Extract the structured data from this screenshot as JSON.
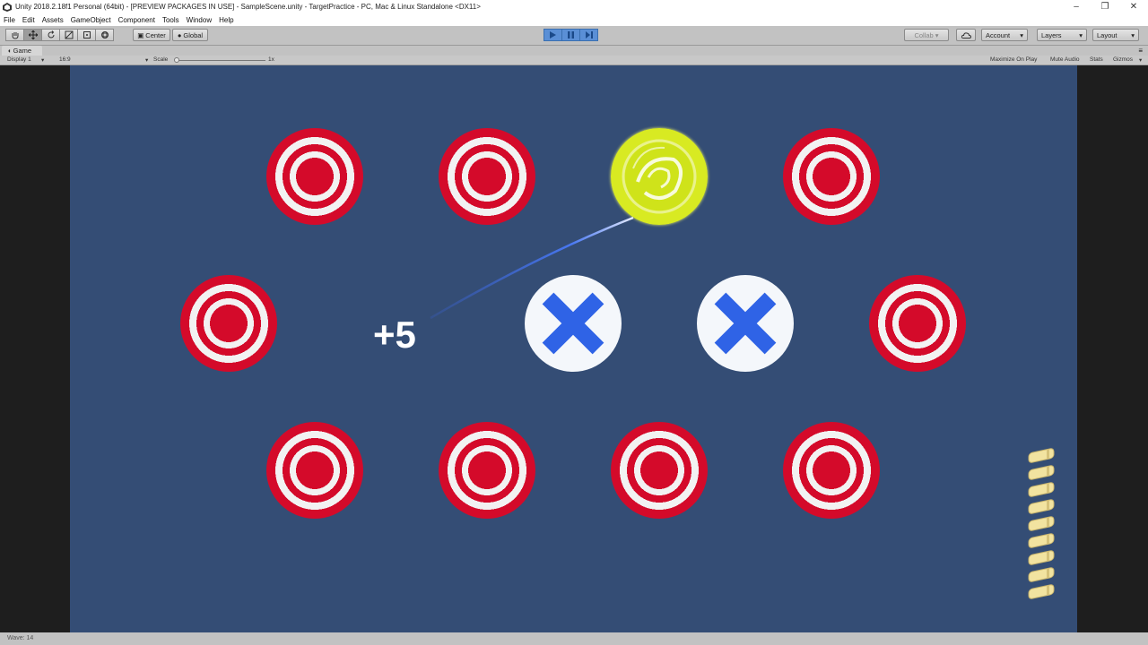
{
  "window": {
    "title": "Unity 2018.2.18f1 Personal (64bit) - [PREVIEW PACKAGES IN USE] - SampleScene.unity - TargetPractice - PC, Mac & Linux Standalone <DX11>",
    "controls": [
      "–",
      "❐",
      "✕"
    ]
  },
  "menu": {
    "items": [
      "File",
      "Edit",
      "Assets",
      "GameObject",
      "Component",
      "Tools",
      "Window",
      "Help"
    ]
  },
  "toolbar": {
    "tools": [
      "hand-tool",
      "move-tool",
      "rotate-tool",
      "scale-tool",
      "rect-tool",
      "transform-tool"
    ],
    "pivot_label": "Center",
    "space_label": "Global",
    "collab_label": "Collab ▾",
    "account_label": "Account",
    "layers_label": "Layers",
    "layout_label": "Layout"
  },
  "game_tab": {
    "label": "Game"
  },
  "game_toolbar": {
    "display": "Display 1",
    "aspect": "16:9",
    "scale_label": "Scale",
    "scale_value": "1x",
    "maximize_on_play": "Maximize On Play",
    "mute_audio": "Mute Audio",
    "stats": "Stats",
    "gizmos": "Gizmos"
  },
  "game": {
    "score_popup": "+5",
    "ammo_count": 9,
    "target_colors": {
      "red": "#d40a2a",
      "white": "#f2f2f2",
      "hit": "#cfe31a",
      "x_blue": "#2f63e6"
    }
  },
  "status": {
    "text": "Wave: 14"
  }
}
